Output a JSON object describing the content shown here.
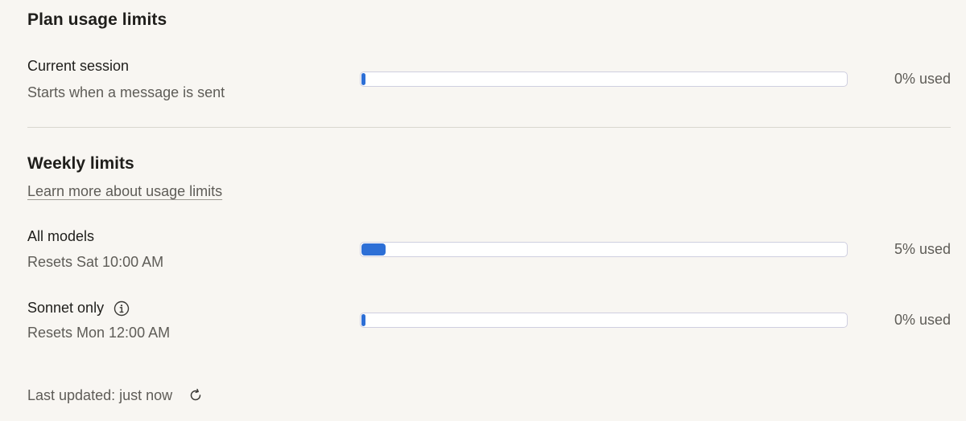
{
  "title": "Plan usage limits",
  "current_session": {
    "label": "Current session",
    "subtitle": "Starts when a message is sent",
    "used_label": "0% used",
    "used_fraction": 0.0
  },
  "weekly": {
    "title": "Weekly limits",
    "learn_more": "Learn more about usage limits",
    "items": [
      {
        "label": "All models",
        "subtitle": "Resets Sat 10:00 AM",
        "used_label": "5% used",
        "used_fraction": 0.05
      },
      {
        "label": "Sonnet only",
        "subtitle": "Resets Mon 12:00 AM",
        "used_label": "0% used",
        "used_fraction": 0.0,
        "icon": "info-icon"
      }
    ]
  },
  "footer": {
    "last_updated": "Last updated: just now",
    "icon": "refresh-icon"
  },
  "colors": {
    "accent": "#2d6fd6",
    "background": "#f8f6f2"
  }
}
